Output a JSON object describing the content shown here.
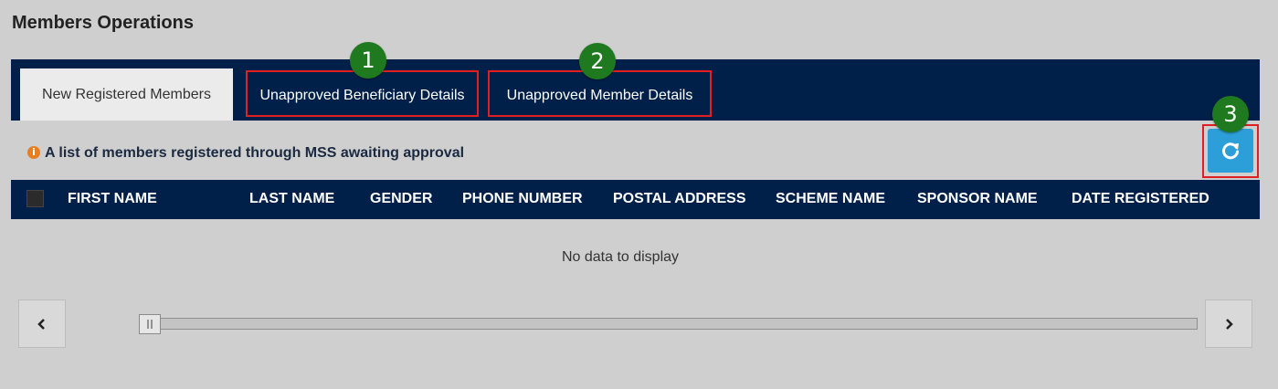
{
  "page": {
    "title": "Members Operations"
  },
  "tabs": [
    {
      "label": "New Registered Members",
      "active": true
    },
    {
      "label": "Unapproved Beneficiary Details",
      "active": false
    },
    {
      "label": "Unapproved Member Details",
      "active": false
    }
  ],
  "callouts": [
    "1",
    "2",
    "3"
  ],
  "info": {
    "icon": "info-icon",
    "text": "A list of members registered through MSS awaiting approval"
  },
  "grid": {
    "columns": [
      "FIRST NAME",
      "LAST NAME",
      "GENDER",
      "PHONE NUMBER",
      "POSTAL ADDRESS",
      "SCHEME NAME",
      "SPONSOR NAME",
      "DATE REGISTERED"
    ],
    "empty_text": "No data to display"
  },
  "colors": {
    "nav_bg": "#001f49",
    "refresh_button": "#2c9fd8",
    "callout": "#1f7a1f",
    "highlight_border": "#e02020",
    "info_icon": "#e67e22"
  },
  "scroll": {
    "position": 0
  }
}
